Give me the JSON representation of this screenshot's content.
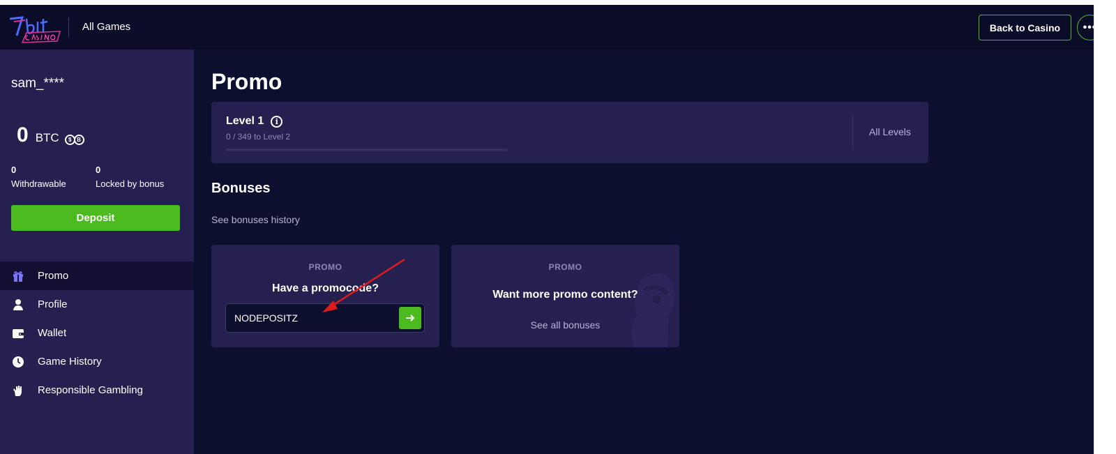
{
  "header": {
    "all_games": "All Games",
    "back_to_casino": "Back to Casino",
    "more_label": "•••"
  },
  "sidebar": {
    "username": "sam_****",
    "balance": {
      "amount": "0",
      "currency": "BTC",
      "icon_labels": [
        "$",
        "B"
      ]
    },
    "withdrawable": {
      "value": "0",
      "label": "Withdrawable"
    },
    "locked": {
      "value": "0",
      "label": "Locked by bonus"
    },
    "deposit_label": "Deposit",
    "nav": [
      {
        "label": "Promo",
        "icon": "gift-icon",
        "active": true
      },
      {
        "label": "Profile",
        "icon": "user-icon",
        "active": false
      },
      {
        "label": "Wallet",
        "icon": "wallet-icon",
        "active": false
      },
      {
        "label": "Game History",
        "icon": "clock-icon",
        "active": false
      },
      {
        "label": "Responsible Gambling",
        "icon": "hand-icon",
        "active": false
      }
    ]
  },
  "main": {
    "title": "Promo",
    "level": {
      "title": "Level 1",
      "progress_text": "0 / 349 to Level 2",
      "progress_fraction": 0,
      "all_levels": "All Levels"
    },
    "bonuses_title": "Bonuses",
    "bonuses_history": "See bonuses history",
    "promo_card": {
      "eyebrow": "PROMO",
      "heading": "Have a promocode?",
      "input_value": "NODEPOSITZ"
    },
    "more_card": {
      "eyebrow": "PROMO",
      "heading": "Want more promo content?",
      "link": "See all bonuses"
    }
  },
  "colors": {
    "background": "#0d0f2e",
    "panel": "#25204f",
    "accent_green": "#4cbb1f",
    "annotation_red": "#e01b1b"
  }
}
